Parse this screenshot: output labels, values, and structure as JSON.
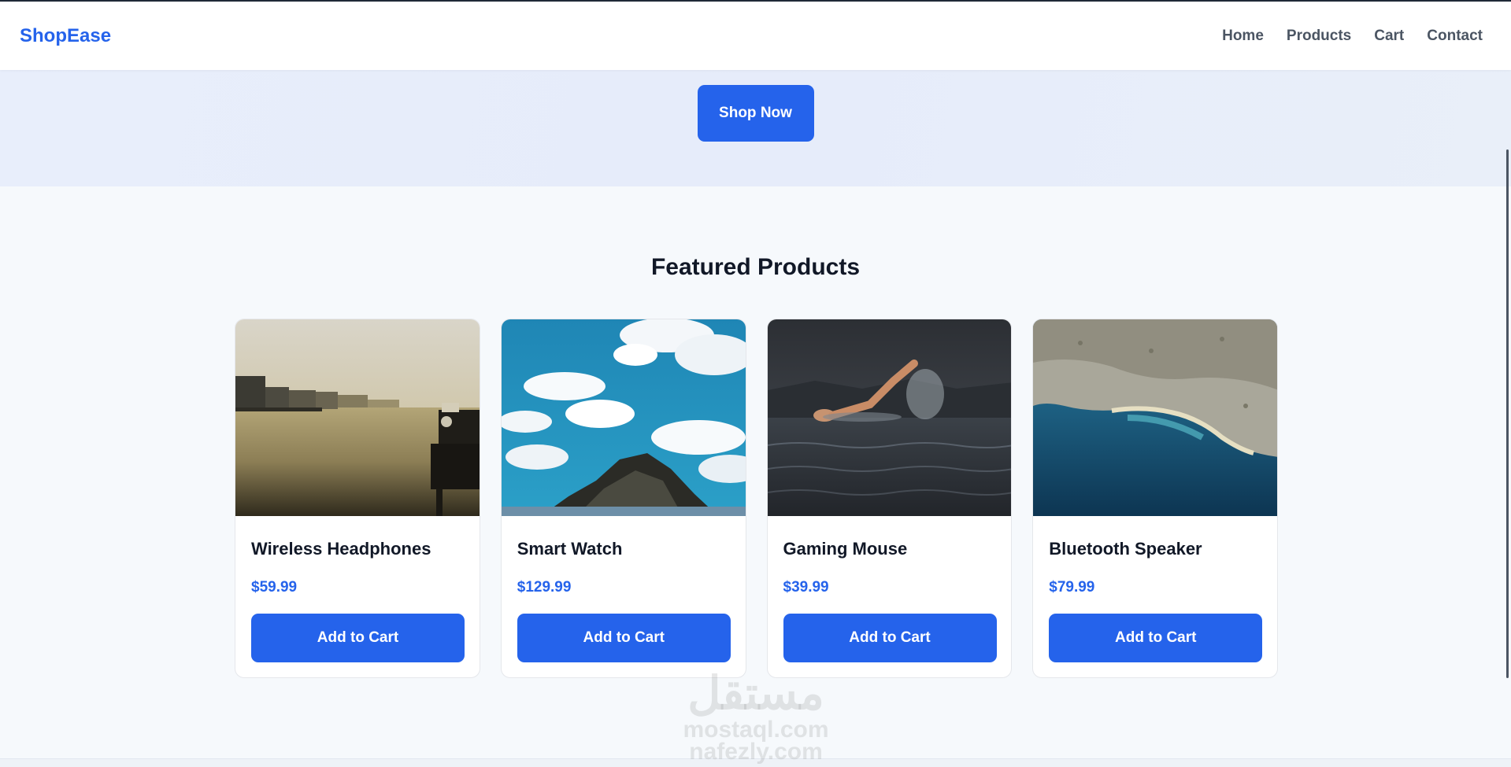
{
  "brand": {
    "name": "ShopEase"
  },
  "nav": {
    "items": [
      {
        "label": "Home"
      },
      {
        "label": "Products"
      },
      {
        "label": "Cart"
      },
      {
        "label": "Contact"
      }
    ]
  },
  "hero": {
    "cta_label": "Shop Now"
  },
  "featured": {
    "title": "Featured Products",
    "products": [
      {
        "name": "Wireless Headphones",
        "price": "$59.99",
        "button_label": "Add to Cart",
        "image": "river-harbor-photo"
      },
      {
        "name": "Smart Watch",
        "price": "$129.99",
        "button_label": "Add to Cart",
        "image": "sky-cliff-photo"
      },
      {
        "name": "Gaming Mouse",
        "price": "$39.99",
        "button_label": "Add to Cart",
        "image": "swimmer-photo"
      },
      {
        "name": "Bluetooth Speaker",
        "price": "$79.99",
        "button_label": "Add to Cart",
        "image": "aerial-coast-photo"
      }
    ]
  },
  "watermark": {
    "mark": "مستقل",
    "lines": [
      "mostaql.com",
      "nafezly.com"
    ]
  },
  "colors": {
    "accent": "#2563eb",
    "nav_text": "#4b5563",
    "heading": "#111827",
    "page_bg": "#f6f9fc",
    "hero_bg": "#e8eefb"
  }
}
